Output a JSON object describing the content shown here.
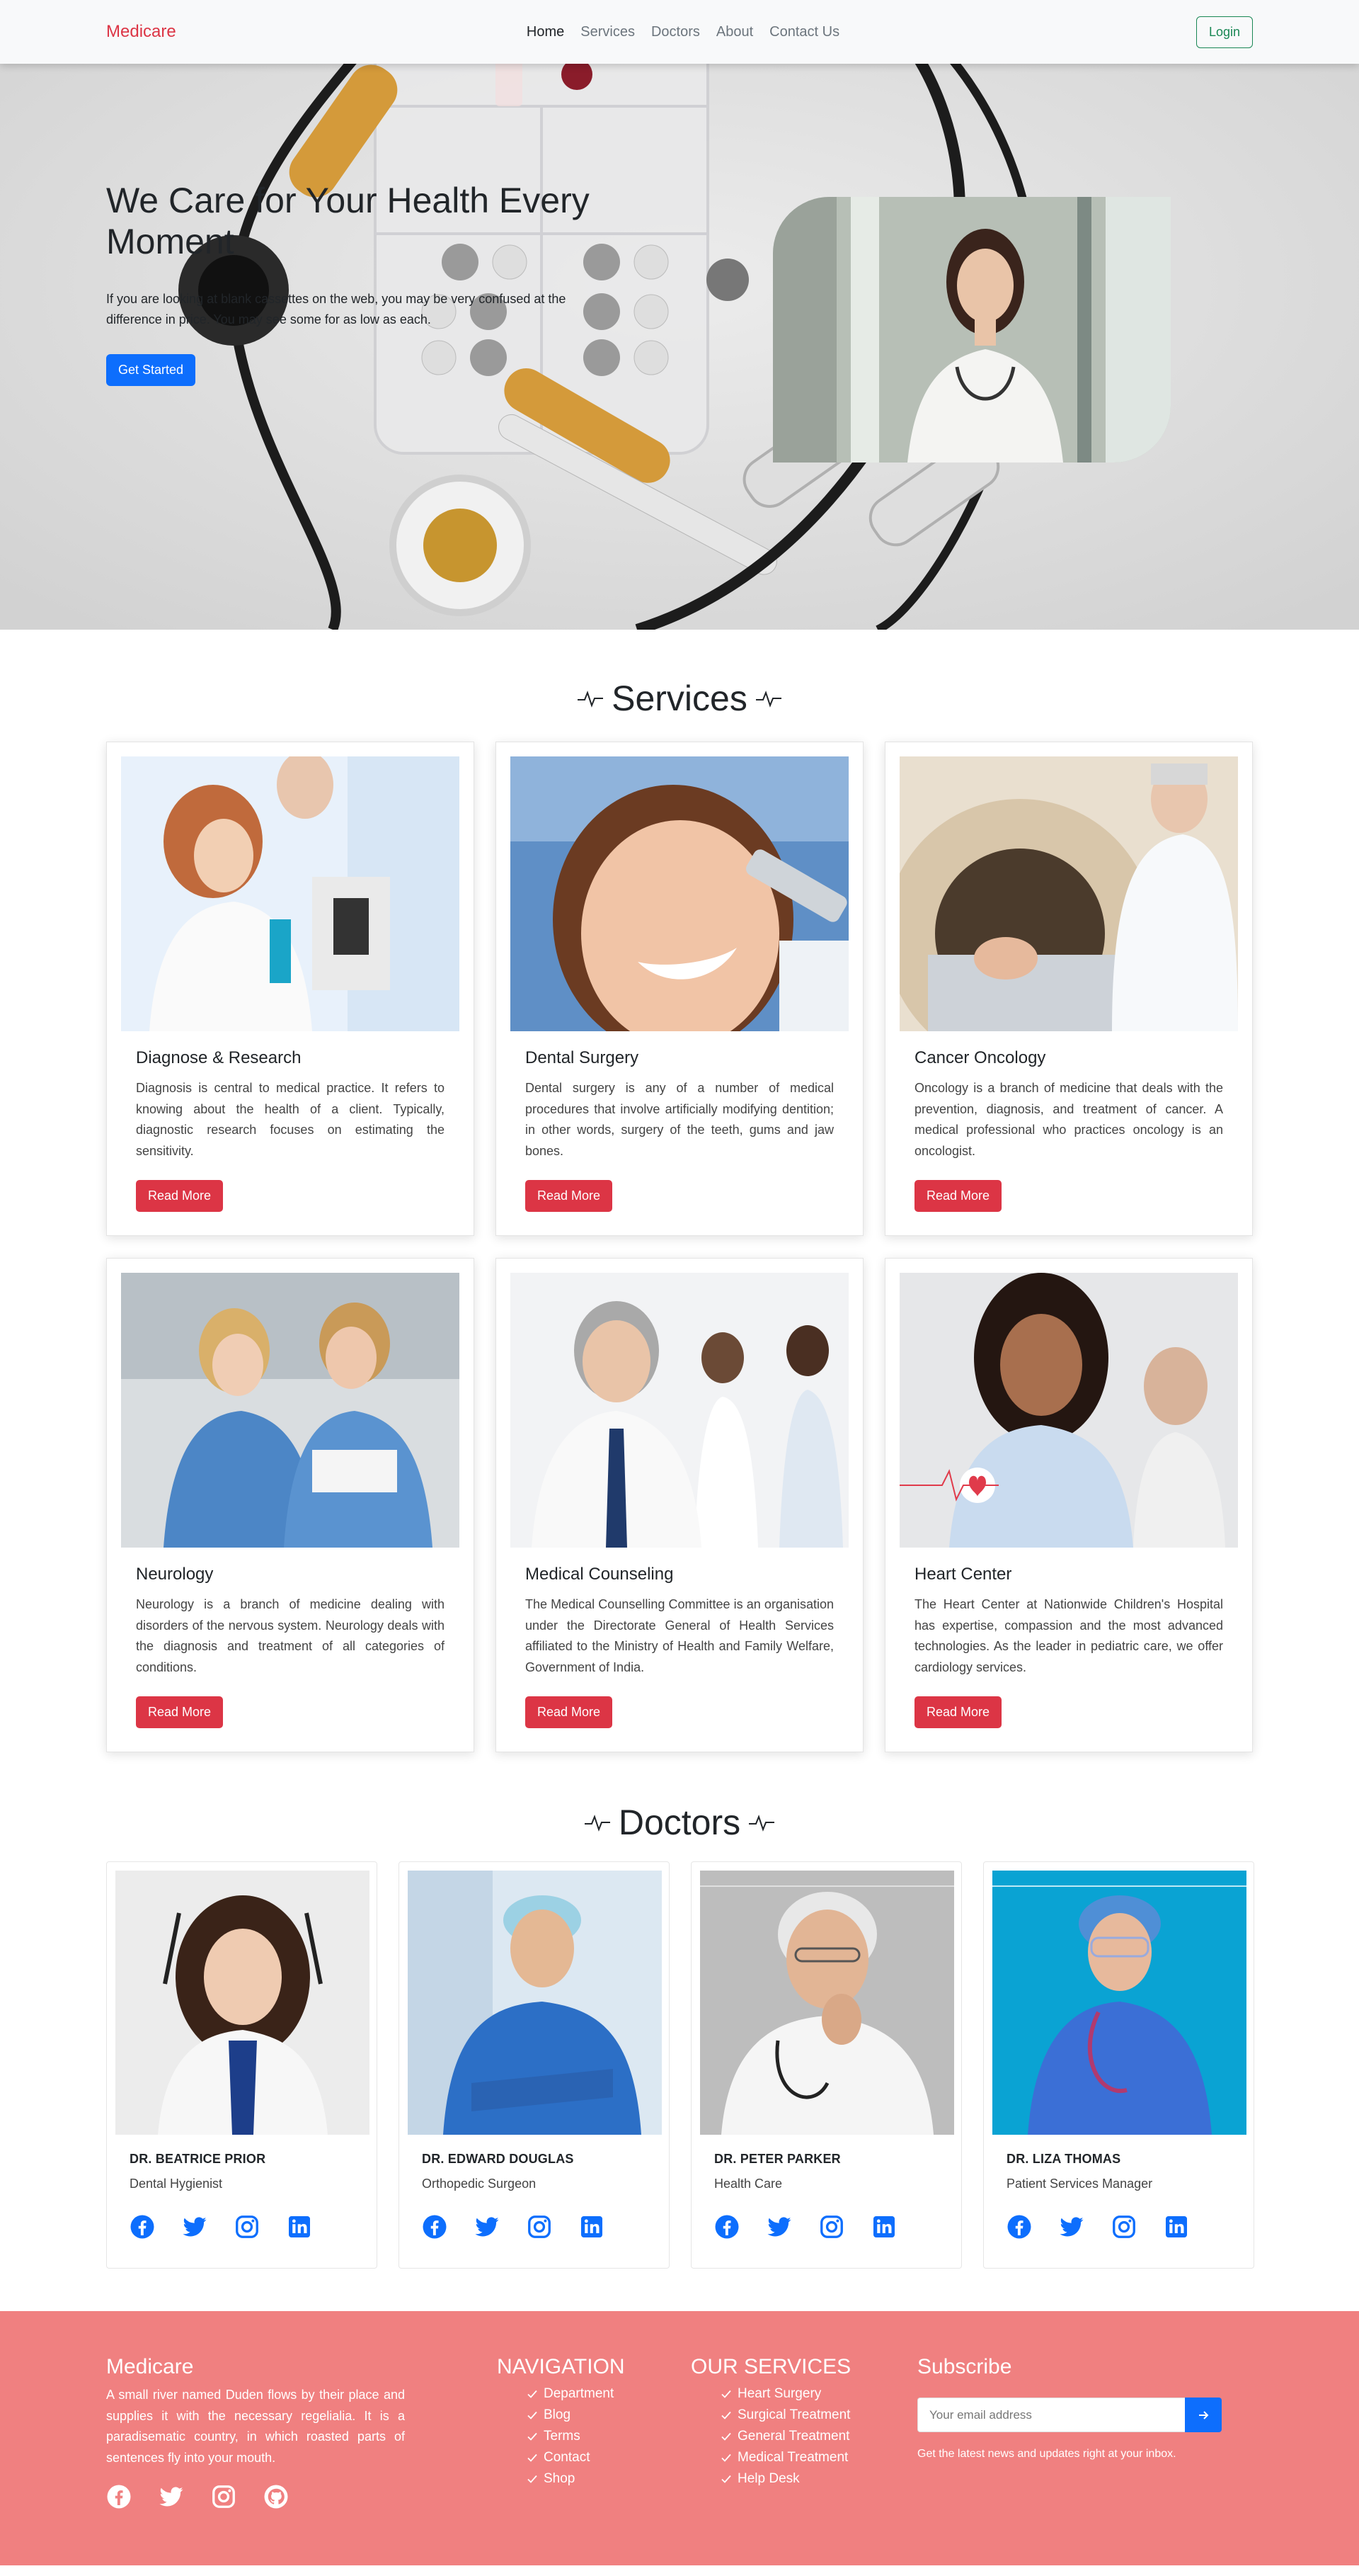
{
  "nav": {
    "brand": "Medicare",
    "links": [
      "Home",
      "Services",
      "Doctors",
      "About",
      "Contact Us"
    ],
    "login": "Login"
  },
  "hero": {
    "title": "We Care for Your Health Every Moment",
    "description": "If you are looking at blank cassettes on the web, you may be very confused at the difference in price. You may see some for as low as each.",
    "button": "Get Started"
  },
  "services": {
    "title": "Services",
    "read_more": "Read More",
    "items": [
      {
        "title": "Diagnose & Research",
        "desc": "Diagnosis is central to medical practice. It refers to knowing about the health of a client. Typically, diagnostic research focuses on estimating the sensitivity."
      },
      {
        "title": "Dental Surgery",
        "desc": "Dental surgery is any of a number of medical procedures that involve artificially modifying dentition; in other words, surgery of the teeth, gums and jaw bones."
      },
      {
        "title": "Cancer Oncology",
        "desc": "Oncology is a branch of medicine that deals with the prevention, diagnosis, and treatment of cancer. A medical professional who practices oncology is an oncologist."
      },
      {
        "title": "Neurology",
        "desc": "Neurology is a branch of medicine dealing with disorders of the nervous system. Neurology deals with the diagnosis and treatment of all categories of conditions."
      },
      {
        "title": "Medical Counseling",
        "desc": "The Medical Counselling Committee is an organisation under the Directorate General of Health Services affiliated to the Ministry of Health and Family Welfare, Government of India."
      },
      {
        "title": "Heart Center",
        "desc": "The Heart Center at Nationwide Children's Hospital has expertise, compassion and the most advanced technologies. As the leader in pediatric care, we offer cardiology services."
      }
    ]
  },
  "doctors": {
    "title": "Doctors",
    "items": [
      {
        "name": "DR. BEATRICE PRIOR",
        "role": "Dental Hygienist"
      },
      {
        "name": "DR. EDWARD DOUGLAS",
        "role": "Orthopedic Surgeon"
      },
      {
        "name": "DR. PETER PARKER",
        "role": "Health Care"
      },
      {
        "name": "DR. LIZA THOMAS",
        "role": "Patient Services Manager"
      }
    ]
  },
  "footer": {
    "brand": "Medicare",
    "about": "A small river named Duden flows by their place and supplies it with the necessary regelialia. It is a paradisematic country, in which roasted parts of sentences fly into your mouth.",
    "nav_title": "NAVIGATION",
    "nav_items": [
      "Department",
      "Blog",
      "Terms",
      "Contact",
      "Shop"
    ],
    "services_title": "OUR SERVICES",
    "service_items": [
      "Heart Surgery",
      "Surgical Treatment",
      "General Treatment",
      "Medical Treatment",
      "Help Desk"
    ],
    "subscribe_title": "Subscribe",
    "email_placeholder": "Your email address",
    "subscribe_note": "Get the latest news and updates right at your inbox."
  },
  "colors": {
    "brand_red": "#dc3545",
    "primary_blue": "#0d6efd",
    "login_green": "#198754",
    "footer_bg": "#f08080"
  }
}
